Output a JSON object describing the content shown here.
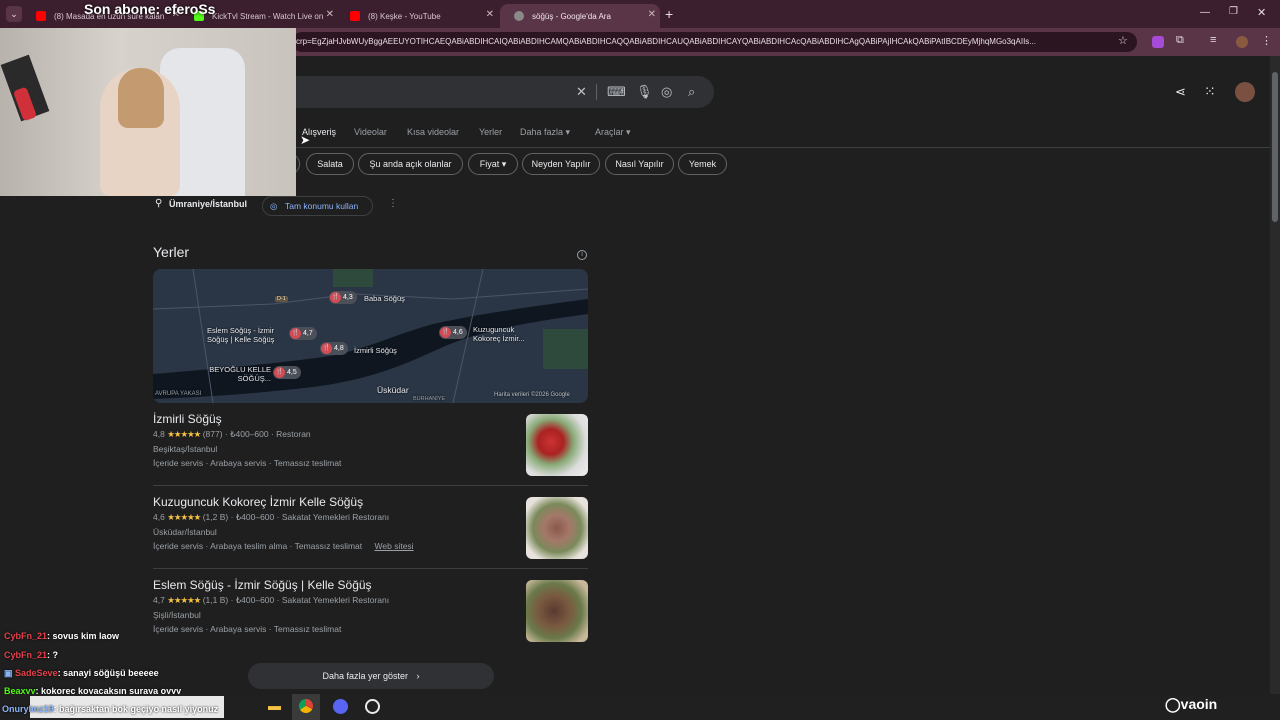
{
  "overlay": {
    "banner": "Son abone: eferoSs"
  },
  "tabs": [
    {
      "label": "(8) Masada en uzun süre kalan",
      "fav_color": "#ff0000"
    },
    {
      "label": "KickTvl Stream - Watch Live on",
      "fav_color": "#53fc18"
    },
    {
      "label": "(8) Keşke - YouTube",
      "fav_color": "#ff0000"
    },
    {
      "label": "söğüş - Google'da Ara",
      "fav_color": "#4285f4"
    }
  ],
  "address_bar": {
    "url": "crp=EgZjaHJvbWUyBggAEEUYOTIHCAEQABiABDIHCAIQABiABDIHCAMQABiABDIHCAQQABiABDIHCAUQABiABDIHCAYQABiABDIHCAcQABiABDIHCAgQABiPAjIHCAkQABiPAtIBCDEyMjhqMGo3qAIIs..."
  },
  "nav_tabs": [
    "Alışveriş",
    "Videolar",
    "Kısa videolar",
    "Yerler",
    "Daha fazla",
    "Araçlar"
  ],
  "chips": [
    "Salata",
    "Şu anda açık olanlar",
    "Fiyat",
    "Neyden Yapılır",
    "Nasıl Yapılır",
    "Yemek"
  ],
  "location": {
    "text": "Ümraniye/İstanbul",
    "button": "Tam konumu kullan"
  },
  "places_heading": "Yerler",
  "map": {
    "pins": [
      {
        "rating": "4,3",
        "label": "Baba Söğüş"
      },
      {
        "rating": "4,7",
        "label": "Eslem Söğüş - İzmir Söğüş | Kelle Söğüş"
      },
      {
        "rating": "4,8",
        "label": "İzmirli Söğüş"
      },
      {
        "rating": "4,6",
        "label": "Kuzuguncuk Kokoreç İzmir..."
      },
      {
        "rating": "4,5",
        "label": "BEYOĞLU KELLE SÖĞÜŞ..."
      }
    ],
    "areas": [
      "Üsküdar",
      "AVRUPA YAKASI",
      "BURHANİYE",
      "D-1"
    ],
    "credit": "Harita verileri ©2026 Google"
  },
  "results": [
    {
      "name": "İzmirli Söğüş",
      "rating": "4,8",
      "stars": "★★★★★",
      "reviews": "(877)",
      "price": "₺400–600",
      "type": "Restoran",
      "address": "Beşiktaş/İstanbul",
      "services": [
        "İçeride servis",
        "Arabaya servis",
        "Temassız teslimat"
      ],
      "website": ""
    },
    {
      "name": "Kuzuguncuk Kokoreç İzmir Kelle Söğüş",
      "rating": "4,6",
      "stars": "★★★★★",
      "reviews": "(1,2 B)",
      "price": "₺400–600",
      "type": "Sakatat Yemekleri Restoranı",
      "address": "Üsküdar/İstanbul",
      "services": [
        "İçeride servis",
        "Arabaya teslim alma",
        "Temassız teslimat"
      ],
      "website": "Web sitesi"
    },
    {
      "name": "Eslem Söğüş - İzmir Söğüş | Kelle Söğüş",
      "rating": "4,7",
      "stars": "★★★★★",
      "reviews": "(1,1 B)",
      "price": "₺400–600",
      "type": "Sakatat Yemekleri Restoranı",
      "address": "Şişli/İstanbul",
      "services": [
        "İçeride servis",
        "Arabaya servis",
        "Temassız teslimat"
      ],
      "website": ""
    }
  ],
  "more_places": "Daha fazla yer göster",
  "chat": [
    {
      "user": "CybFn_21",
      "msg": ": sovus kim laow"
    },
    {
      "user": "CybFn_21",
      "msg": ": ?"
    },
    {
      "user": "SadeSeve",
      "msg": ": sanayi söğüşü beeeee"
    },
    {
      "user": "Beaxyy",
      "msg": ": kokoreç koyacaksın suraya oyyy"
    },
    {
      "user": "Onurylmz19",
      "msg": ": bağırsaktan bok geçiyo nasıl yiyonuz"
    }
  ],
  "colors": {
    "tab_strip": "#3c1f2f",
    "toolbar": "#5a3447",
    "page_bg": "#1f1f1f",
    "star": "#f5c242",
    "pin": "#d34b55"
  }
}
